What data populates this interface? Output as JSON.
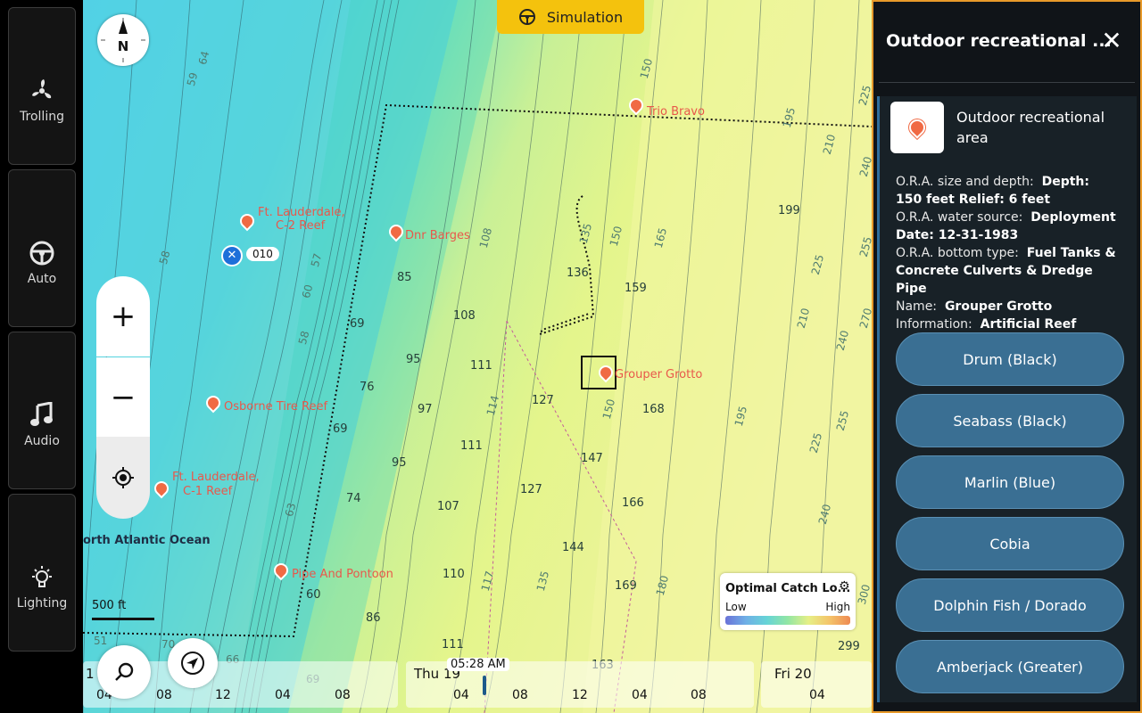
{
  "sidebar": {
    "items": [
      {
        "label": "Trolling",
        "icon": "propeller-icon"
      },
      {
        "label": "Auto",
        "icon": "steering-wheel-icon"
      },
      {
        "label": "Audio",
        "icon": "music-note-icon"
      },
      {
        "label": "Lighting",
        "icon": "light-bulb-icon"
      }
    ]
  },
  "map": {
    "simulation_label": "Simulation",
    "compass_label": "N",
    "scale_label": "500 ft",
    "waypoint_label": "010",
    "ocean_label": "orth Atlantic Ocean",
    "pois": [
      {
        "label": "Trio Bravo"
      },
      {
        "label": "Ft. Lauderdale,"
      },
      {
        "label": "C-2 Reef"
      },
      {
        "label": "Dnr Barges"
      },
      {
        "label": "Grouper Grotto"
      },
      {
        "label": "Osborne Tire Reef"
      },
      {
        "label": "Ft. Lauderdale,"
      },
      {
        "label": "C-1 Reef"
      },
      {
        "label": "Pipe And Pontoon"
      }
    ],
    "depths": [
      "199",
      "85",
      "136",
      "159",
      "108",
      "69",
      "111",
      "95",
      "76",
      "127",
      "168",
      "97",
      "69",
      "111",
      "147",
      "95",
      "127",
      "166",
      "74",
      "107",
      "144",
      "110",
      "169",
      "60",
      "86",
      "111",
      "299",
      "163"
    ],
    "contours": [
      "150",
      "195",
      "210",
      "225",
      "240",
      "255",
      "270",
      "165",
      "108",
      "135",
      "150",
      "114",
      "150",
      "195",
      "225",
      "240",
      "255",
      "210",
      "225",
      "240",
      "300",
      "117",
      "135",
      "180",
      "64",
      "59",
      "58",
      "60",
      "57",
      "58",
      "63",
      "70",
      "66",
      "69",
      "51"
    ],
    "catch_legend": {
      "title": "Optimal Catch Lo...",
      "low": "Low",
      "high": "High",
      "settings_icon": "gear-icon"
    },
    "timeline": {
      "current_time": "05:28 AM",
      "day1": "Thu 19",
      "day2": "Fri 20",
      "day0_partial": "1",
      "ticks": [
        "04",
        "08",
        "12",
        "04",
        "08",
        "04",
        "08",
        "12",
        "04",
        "08",
        "04"
      ]
    }
  },
  "panel": {
    "title": "Outdoor recreational ...",
    "poi_type": "Outdoor recreational area",
    "attributes": [
      {
        "key": "O.R.A. size and depth:",
        "value": "Depth: 150 feet  Relief: 6 feet"
      },
      {
        "key": "O.R.A. water source:",
        "value": "Deployment Date: 12-31-1983"
      },
      {
        "key": "O.R.A. bottom type:",
        "value": "Fuel Tanks & Concrete Culverts & Dredge Pipe"
      },
      {
        "key": "Name:",
        "value": "Grouper Grotto"
      },
      {
        "key": "Information:",
        "value": "Artificial Reef"
      }
    ],
    "fish_buttons": [
      "Drum (Black)",
      "Seabass (Black)",
      "Marlin (Blue)",
      "Cobia",
      "Dolphin Fish / Dorado",
      "Amberjack (Greater)"
    ]
  }
}
